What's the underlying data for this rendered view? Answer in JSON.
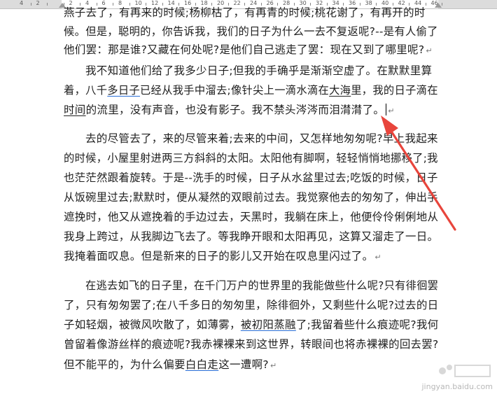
{
  "ruler": {
    "labels": [
      "4",
      "2",
      "",
      "2",
      "4",
      "6",
      "8",
      "10",
      "12",
      "14",
      "16",
      "18",
      "20",
      "22",
      "24",
      "26",
      "28",
      "30",
      "32",
      "34",
      "36",
      "38",
      "40",
      "42",
      "44",
      "46"
    ]
  },
  "document": {
    "lines": [
      [
        {
          "t": "燕子去了，有再来的时候;杨柳枯了，有再青的时候;桃花谢了，有再开的时"
        }
      ],
      [
        {
          "t": "候。但是，聪明的，你告诉我，我们的日子为什么一去不复返呢?--是有人偷了"
        }
      ],
      [
        {
          "t": "他们罢：那是谁?又藏在何处呢?是他们自己逃走了罢：现在又到了哪里呢?"
        },
        {
          "t": "↵",
          "mark": true
        }
      ],
      [
        {
          "t": "我不知道他们给了我多少日子;但我的手确乎是渐渐空虚了。在默默里算"
        }
      ],
      [
        {
          "t": "着，八千"
        },
        {
          "t": "多日子",
          "u": "blue"
        },
        {
          "t": "已经从我手中溜去;像针尖上一滴水滴在"
        },
        {
          "t": "大海",
          "u": "black"
        },
        {
          "t": "里，我的日子滴在"
        }
      ],
      [
        {
          "t": "时间",
          "u": "black"
        },
        {
          "t": "的流里，没有声音，也没有影子。我不禁头涔涔而泪潸潸了。"
        },
        {
          "t": "↵",
          "mark": true,
          "cursor": true
        }
      ],
      [
        {
          "t": "去的尽管去了，来的尽管来着;去来的中间，又怎样地匆匆呢?早上我起来"
        }
      ],
      [
        {
          "t": "的时候，小屋里射进两三方斜斜的太阳。太阳他有脚啊，轻轻悄悄地挪移了;我"
        }
      ],
      [
        {
          "t": "也茫茫然跟着旋转。于是--洗手的时候，日子从水盆里过去;吃饭的时候，日子"
        }
      ],
      [
        {
          "t": "从饭碗里过去;默默时，便从凝然的双眼前过去。我觉察他去的匆匆了，伸出手"
        }
      ],
      [
        {
          "t": "遮挽时，他又从遮挽着的手边过去，天黑时，我躺在床上，他便伶伶俐俐地从"
        }
      ],
      [
        {
          "t": "我身上跨过，从我脚边飞去了。等我睁开眼和太阳再见，这算又溜走了一日。"
        }
      ],
      [
        {
          "t": "我掩着面叹息。但是新来的日子的影儿又开始在叹息里闪过了。"
        },
        {
          "t": "↵",
          "mark": true
        }
      ],
      [
        {
          "t": "在逃去如飞的日子里，在千门万户的世界里的我能做些什么呢?只有徘徊罢"
        }
      ],
      [
        {
          "t": "了，只有匆匆罢了;在八千多日的匆匆里，除徘徊外，又剩些什么呢?过去的日"
        }
      ],
      [
        {
          "t": "子如轻烟，被微风吹散了，如薄雾，"
        },
        {
          "t": "被初阳蒸融",
          "u": "blue"
        },
        {
          "t": "了;我留着些什么痕迹呢?我何"
        }
      ],
      [
        {
          "t": "曾留着像游丝样的痕迹呢?我赤裸裸来到这世界，转眼间也将赤裸裸的回去罢?"
        }
      ],
      [
        {
          "t": "但不能平的，为什么偏要"
        },
        {
          "t": "白白走",
          "u": "blue"
        },
        {
          "t": "这一遭啊?"
        },
        {
          "t": "↵",
          "mark": true
        }
      ]
    ]
  },
  "annotation": {
    "color": "#e8453c"
  },
  "watermark": {
    "text": "jingyan.baidu.com"
  }
}
